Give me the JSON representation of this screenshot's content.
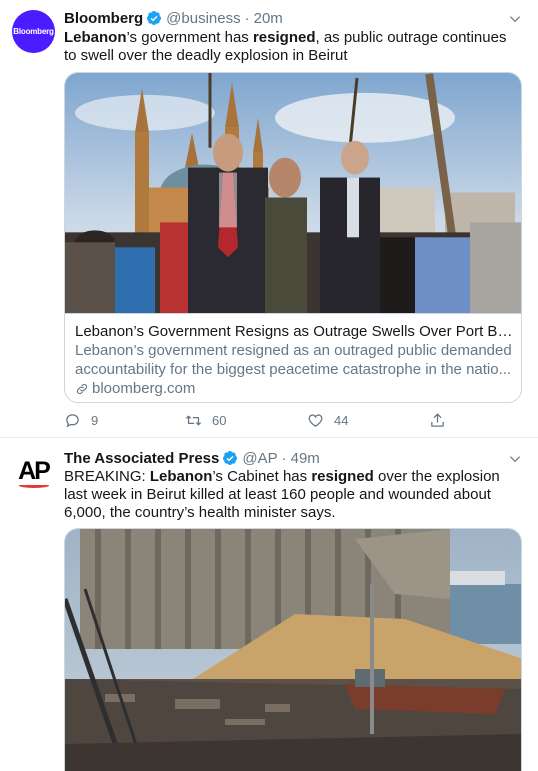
{
  "tweets": [
    {
      "avatar_text": "Bloomberg",
      "name": "Bloomberg",
      "handle": "@business",
      "separator": "·",
      "time": "20m",
      "text_parts": [
        "Lebanon",
        "’s government has ",
        "resigned",
        ", as public outrage continues to swell over the deadly explosion in Beirut"
      ],
      "card": {
        "title": "Lebanon’s Government Resigns as Outrage Swells Over Port Blast",
        "description": "Lebanon’s government resigned as an outraged public demanded accountability for the biggest peacetime catastrophe in the natio...",
        "domain": "bloomberg.com"
      },
      "actions": {
        "reply_count": "9",
        "retweet_count": "60",
        "like_count": "44"
      }
    },
    {
      "avatar_text": "AP",
      "name": "The Associated Press",
      "handle": "@AP",
      "separator": "·",
      "time": "49m",
      "text_parts": [
        "BREAKING: ",
        "Lebanon",
        "’s Cabinet has ",
        "resigned",
        " over the explosion last week in Beirut killed at least 160 people and wounded about 6,000, the country’s health minister says."
      ]
    }
  ],
  "colors": {
    "bloomberg_avatar": "#4b1cff",
    "verified_blue": "#1da1f2",
    "secondary_text": "#657786",
    "ap_red": "#e8372c"
  },
  "icons": {
    "verified": "verified-badge-icon",
    "chevron": "chevron-down-icon",
    "reply": "reply-icon",
    "retweet": "retweet-icon",
    "like": "heart-icon",
    "share": "share-icon",
    "link": "link-icon"
  }
}
